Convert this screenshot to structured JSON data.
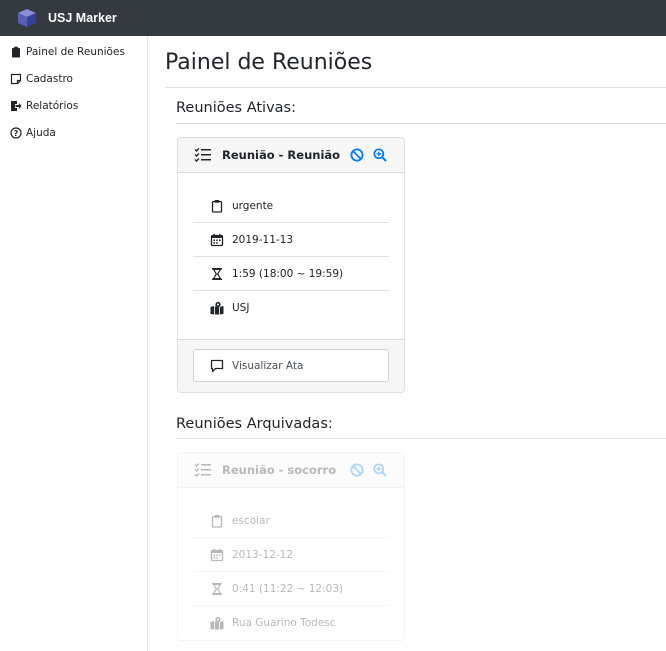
{
  "app": {
    "title": "USJ Marker"
  },
  "sidebar": {
    "items": [
      {
        "label": "Painel de Reuniões",
        "icon": "clipboard-icon"
      },
      {
        "label": "Cadastro",
        "icon": "sticky-note-icon"
      },
      {
        "label": "Relatórios",
        "icon": "sign-out-icon"
      },
      {
        "label": "Ajuda",
        "icon": "question-circle-icon"
      }
    ]
  },
  "main": {
    "title": "Painel de Reuniões",
    "active_section": "Reuniões Ativas:",
    "archived_section": "Reuniões Arquivadas:",
    "active_card": {
      "title": "Reunião - Reunião",
      "category": "urgente",
      "date": "2019-11-13",
      "duration": "1:59 (18:00 ~ 19:59)",
      "location": "USJ",
      "view_label": "Visualizar Ata"
    },
    "archived_card": {
      "title": "Reunião - socorro",
      "category": "escolar",
      "date": "2013-12-12",
      "duration": "0:41 (11:22 ~ 12:03)",
      "location": "Rua Guarino Todesc"
    }
  },
  "colors": {
    "topbar": "#343a40",
    "accent": "#007bff",
    "icon": "#212529"
  }
}
